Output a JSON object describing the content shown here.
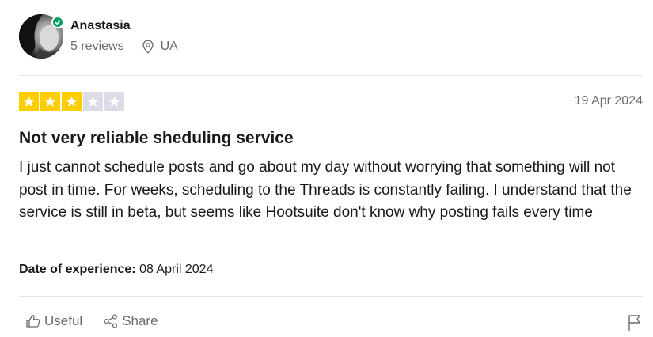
{
  "reviewer": {
    "name": "Anastasia",
    "reviews_count": "5 reviews",
    "location": "UA",
    "verified": true
  },
  "review": {
    "rating": 3,
    "max_rating": 5,
    "date": "19 Apr 2024",
    "title": "Not very reliable sheduling service",
    "body": "I just cannot schedule posts and go about my day without worrying that something will not post in time. For weeks, scheduling to the Threads is constantly failing. I understand that the service is still in beta, but seems like Hootsuite don't know why posting fails every time",
    "experience_label": "Date of experience:",
    "experience_date": "08 April 2024"
  },
  "actions": {
    "useful_label": "Useful",
    "share_label": "Share"
  },
  "colors": {
    "star_filled": "#ffce00",
    "star_empty": "#dcdce6",
    "verified": "#04a05f",
    "muted_text": "#6b6b6b"
  },
  "icons": [
    "verified-check-icon",
    "location-pin-icon",
    "star-icon",
    "thumbs-up-icon",
    "share-icon",
    "flag-icon"
  ]
}
